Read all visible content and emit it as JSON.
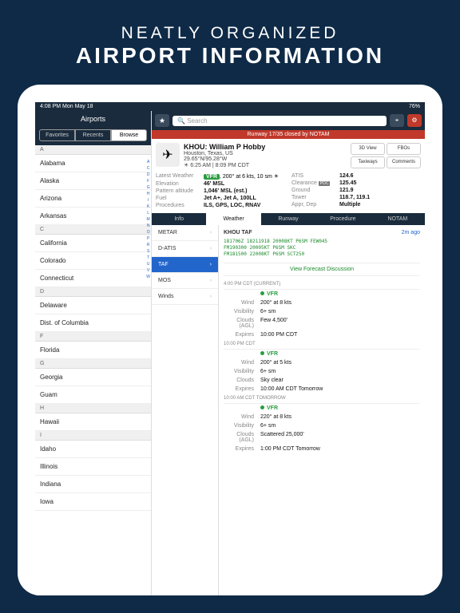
{
  "hero": {
    "sub": "NEATLY ORGANIZED",
    "main": "AIRPORT INFORMATION"
  },
  "status": {
    "time": "4:08 PM   Mon May 18",
    "right": "76%"
  },
  "sidebar": {
    "title": "Airports",
    "seg": [
      "Favorites",
      "Recents",
      "Browse"
    ],
    "alpha": "A\nC\nD\nF\nG\nH\nI\nK\nL\nM\nN\nO\nP\nR\nS\nT\nU\nV\nW",
    "groups": [
      {
        "h": "A",
        "items": [
          "Alabama",
          "Alaska",
          "Arizona",
          "Arkansas"
        ]
      },
      {
        "h": "C",
        "items": [
          "California",
          "Colorado",
          "Connecticut"
        ]
      },
      {
        "h": "D",
        "items": [
          "Delaware",
          "Dist. of Columbia"
        ]
      },
      {
        "h": "F",
        "items": [
          "Florida"
        ]
      },
      {
        "h": "G",
        "items": [
          "Georgia",
          "Guam"
        ]
      },
      {
        "h": "H",
        "items": [
          "Hawaii"
        ]
      },
      {
        "h": "I",
        "items": [
          "Idaho",
          "Illinois",
          "Indiana",
          "Iowa"
        ]
      }
    ]
  },
  "search": {
    "placeholder": "Search"
  },
  "notam": "Runway 17/35 closed by NOTAM",
  "airport": {
    "title": "KHOU: William P Hobby",
    "loc": "Houston, Texas, US",
    "coord": "29.65°N/95.28°W",
    "sunrise": "6:25 AM",
    "sunset": "8:09 PM CDT",
    "btns": [
      "3D View",
      "FBOs",
      "Taxiways",
      "Comments"
    ]
  },
  "details_l": [
    {
      "lbl": "Latest Weather",
      "val": "VFR",
      "extra": ", 200° at 6 kts, 10 sm"
    },
    {
      "lbl": "Elevation",
      "val": "46' MSL"
    },
    {
      "lbl": "Pattern altitude",
      "val": "1,046' MSL (est.)"
    },
    {
      "lbl": "Fuel",
      "val": "Jet A+, Jet A, 100LL"
    },
    {
      "lbl": "Procedures",
      "val": "ILS, GPS, LOC, RNAV"
    }
  ],
  "details_r": [
    {
      "lbl": "ATIS",
      "val": "124.6"
    },
    {
      "lbl": "Clearance",
      "val": "125.45",
      "badge": "PDC"
    },
    {
      "lbl": "Ground",
      "val": "121.9"
    },
    {
      "lbl": "Tower",
      "val": "118.7, 119.1"
    },
    {
      "lbl": "Appr, Dep",
      "val": "Multiple"
    }
  ],
  "tabs": [
    "Info",
    "Weather",
    "Runway",
    "Procedure",
    "NOTAM"
  ],
  "wx_menu": [
    "METAR",
    "D-ATIS",
    "TAF",
    "MOS",
    "Winds"
  ],
  "taf": {
    "title": "KHOU TAF",
    "ago": "2m ago",
    "raw": "181706Z 18211918 20008KT P6SM FEW045\nFM190300 20005KT P6SM SKC\nFM181500 22008KT P6SM SCT250",
    "forecast_link": "View Forecast Discussion",
    "periods": [
      {
        "h": "4:00 PM CDT (CURRENT)",
        "rows": [
          {
            "lbl": "",
            "val": "VFR",
            "vfr": true
          },
          {
            "lbl": "Wind",
            "val": "200° at 8 kts"
          },
          {
            "lbl": "Visibility",
            "val": "6+ sm"
          },
          {
            "lbl": "Clouds (AGL)",
            "val": "Few 4,500'"
          },
          {
            "lbl": "Expires",
            "val": "10:00 PM CDT",
            "link": true
          }
        ]
      },
      {
        "h": "10:00 PM CDT",
        "rows": [
          {
            "lbl": "",
            "val": "VFR",
            "vfr": true
          },
          {
            "lbl": "Wind",
            "val": "200° at 5 kts"
          },
          {
            "lbl": "Visibility",
            "val": "6+ sm"
          },
          {
            "lbl": "Clouds",
            "val": "Sky clear"
          },
          {
            "lbl": "Expires",
            "val": "10:00 AM CDT Tomorrow",
            "link": true
          }
        ]
      },
      {
        "h": "10:00 AM CDT TOMORROW",
        "rows": [
          {
            "lbl": "",
            "val": "VFR",
            "vfr": true
          },
          {
            "lbl": "Wind",
            "val": "220° at 8 kts"
          },
          {
            "lbl": "Visibility",
            "val": "6+ sm"
          },
          {
            "lbl": "Clouds (AGL)",
            "val": "Scattered 25,000'"
          },
          {
            "lbl": "Expires",
            "val": "1:00 PM CDT Tomorrow",
            "link": true
          }
        ]
      }
    ]
  }
}
